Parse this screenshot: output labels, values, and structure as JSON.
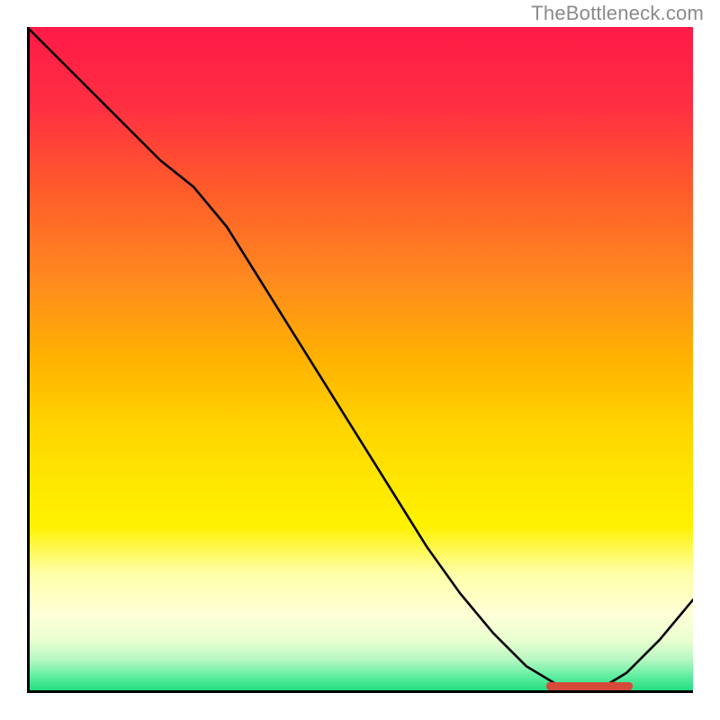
{
  "attribution": "TheBottleneck.com",
  "chart_data": {
    "type": "line",
    "x": [
      0.0,
      0.05,
      0.1,
      0.15,
      0.2,
      0.25,
      0.3,
      0.35,
      0.4,
      0.45,
      0.5,
      0.55,
      0.6,
      0.65,
      0.7,
      0.75,
      0.8,
      0.85,
      0.9,
      0.95,
      1.0
    ],
    "values": [
      1.0,
      0.95,
      0.9,
      0.85,
      0.8,
      0.76,
      0.7,
      0.62,
      0.54,
      0.46,
      0.38,
      0.3,
      0.22,
      0.15,
      0.09,
      0.04,
      0.01,
      0.0,
      0.03,
      0.08,
      0.14
    ],
    "xlim": [
      0,
      1
    ],
    "ylim": [
      0,
      1
    ],
    "minimum_band": {
      "x_start": 0.78,
      "x_end": 0.91
    },
    "title": "",
    "xlabel": "",
    "ylabel": "",
    "background": "red-yellow-green vertical gradient (top=red, bottom=green)"
  }
}
